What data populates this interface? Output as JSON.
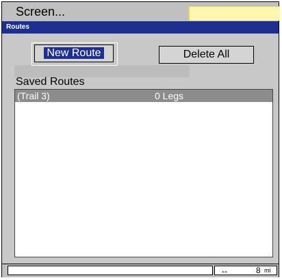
{
  "header": {
    "screen_menu": "Screen...",
    "dialog_title": "Routes"
  },
  "buttons": {
    "new_route": "New Route",
    "delete_all": "Delete All"
  },
  "saved_routes": {
    "label": "Saved Routes",
    "items": [
      {
        "name": "(Trail 3)",
        "legs": "0 Legs"
      }
    ]
  },
  "status": {
    "scale_value": "8",
    "scale_unit": "mi",
    "scale_icon": "double-arrow-icon"
  },
  "colors": {
    "title_bar": "#1f2f8f",
    "selected_row": "#8c8c8c",
    "highlight_box": "#fff6b0"
  }
}
